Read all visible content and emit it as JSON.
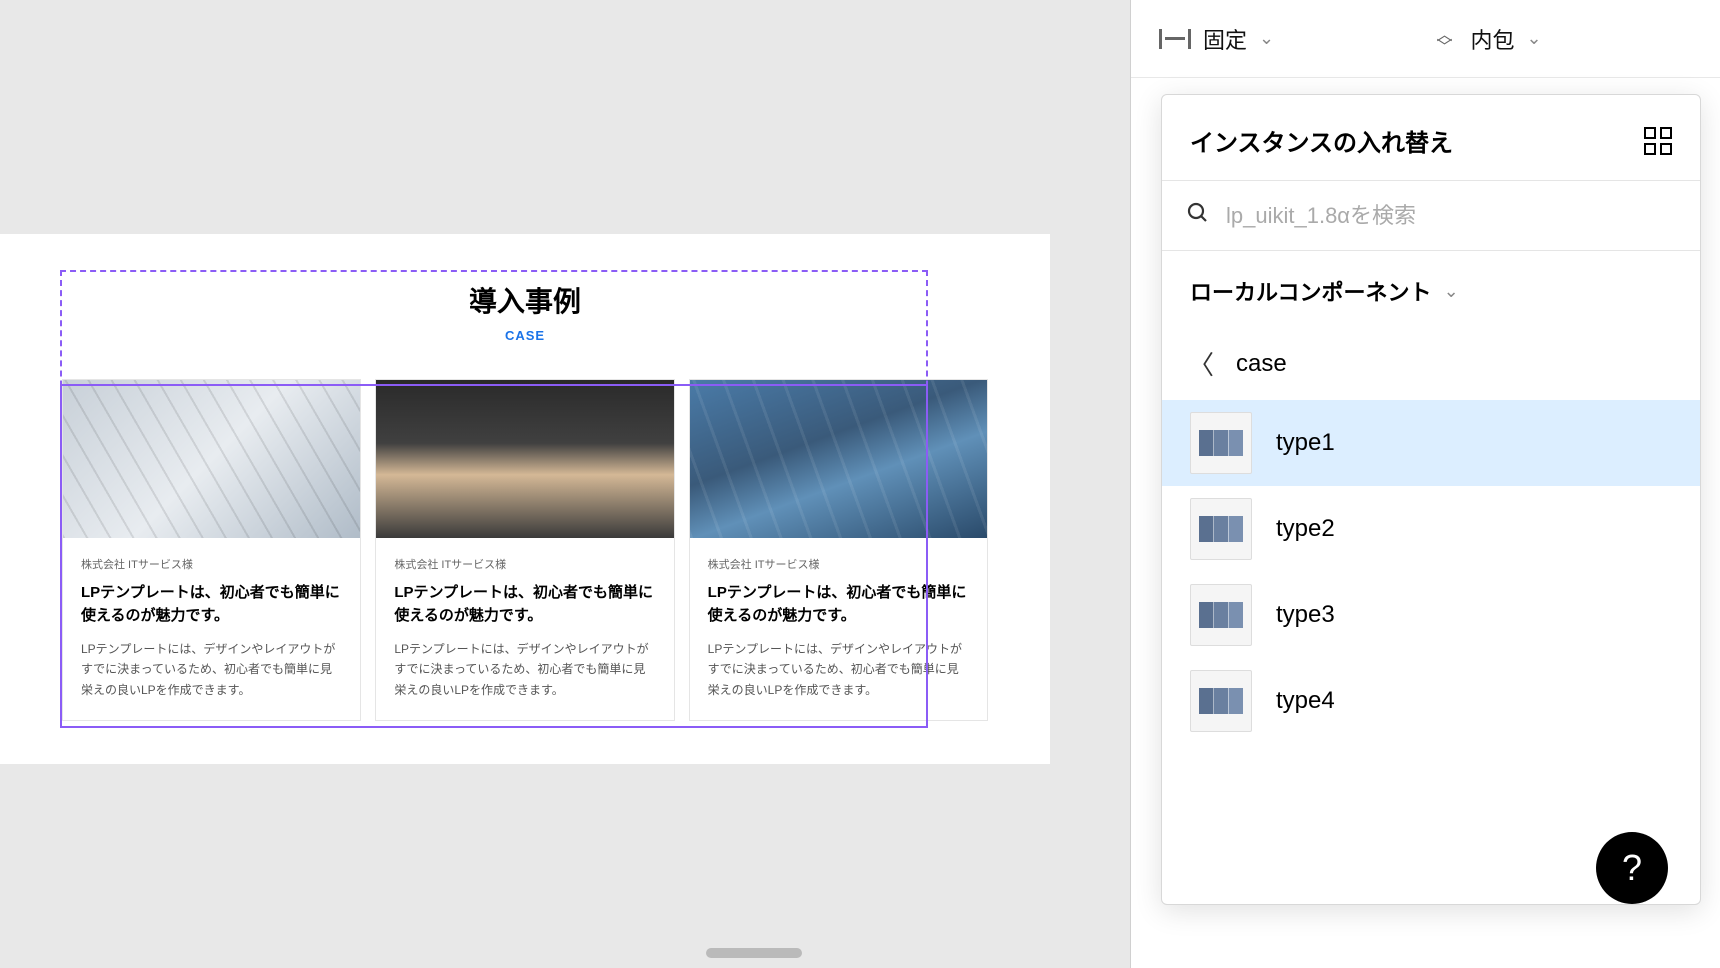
{
  "canvas": {
    "section_title": "導入事例",
    "section_subtitle": "CASE",
    "cards": [
      {
        "company": "株式会社 ITサービス様",
        "title": "LPテンプレートは、初心者でも簡単に使えるのが魅力です。",
        "desc": "LPテンプレートには、デザインやレイアウトがすでに決まっているため、初心者でも簡単に見栄えの良いLPを作成できます。"
      },
      {
        "company": "株式会社 ITサービス様",
        "title": "LPテンプレートは、初心者でも簡単に使えるのが魅力です。",
        "desc": "LPテンプレートには、デザインやレイアウトがすでに決まっているため、初心者でも簡単に見栄えの良いLPを作成できます。"
      },
      {
        "company": "株式会社 ITサービス様",
        "title": "LPテンプレートは、初心者でも簡単に使えるのが魅力です。",
        "desc": "LPテンプレートには、デザインやレイアウトがすでに決まっているため、初心者でも簡単に見栄えの良いLPを作成できます。"
      }
    ]
  },
  "panel": {
    "constraint_h": "固定",
    "constraint_v": "内包",
    "swap_title": "インスタンスの入れ替え",
    "search_placeholder": "lp_uikit_1.8αを検索",
    "scope_label": "ローカルコンポーネント",
    "back_label": "case",
    "variants": [
      {
        "label": "type1",
        "selected": true
      },
      {
        "label": "type2",
        "selected": false
      },
      {
        "label": "type3",
        "selected": false
      },
      {
        "label": "type4",
        "selected": false
      }
    ]
  },
  "help_label": "?"
}
